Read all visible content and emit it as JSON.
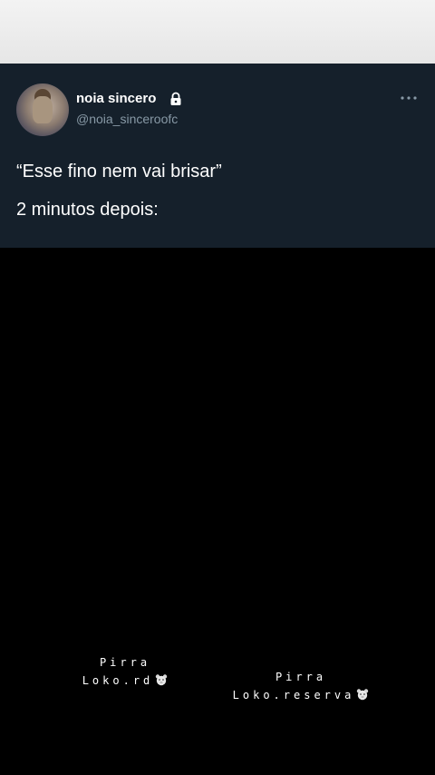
{
  "tweet": {
    "display_name": "noia sincero",
    "handle": "@noia_sinceroofc",
    "line1": "“Esse fino nem vai brisar”",
    "line2": "2 minutos depois:",
    "icons": {
      "lock": "lock-icon",
      "more": "more-options-icon",
      "avatar": "profile-avatar"
    }
  },
  "watermarks": {
    "left": {
      "line1": "Pirra",
      "line2": "Loko.rd",
      "icon": "bear-emoji-icon"
    },
    "right": {
      "line1": "Pirra",
      "line2": "Loko.reserva",
      "icon": "bear-emoji-icon"
    }
  },
  "colors": {
    "card_background": "#15202b",
    "handle_text": "#8899a6",
    "video_background": "#000000",
    "top_bar": "#ececec"
  }
}
